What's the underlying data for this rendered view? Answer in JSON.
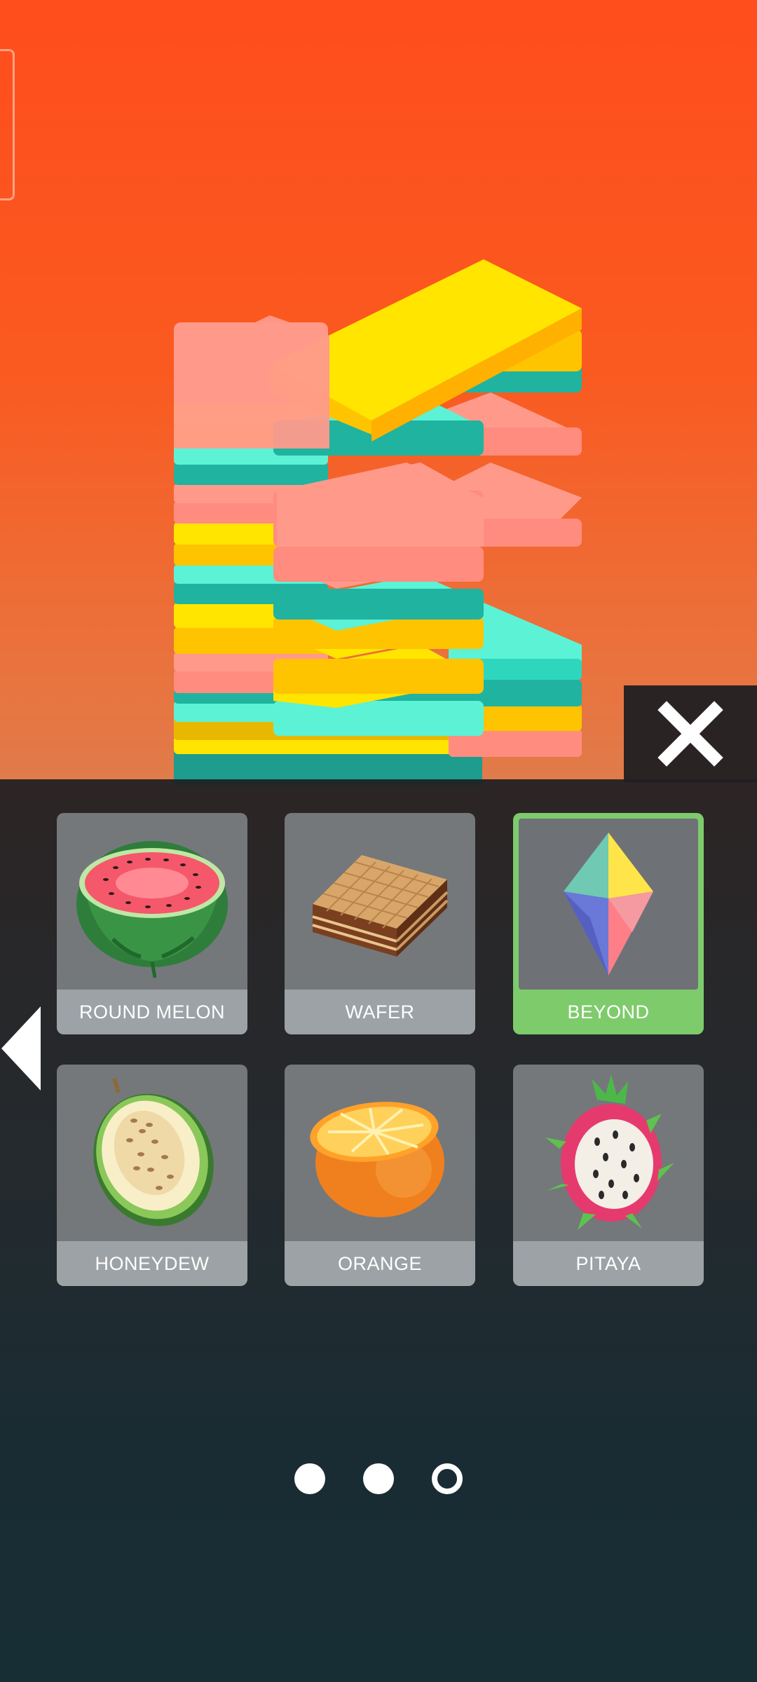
{
  "skins": {
    "items": [
      {
        "label": "ROUND MELON",
        "icon": "watermelon-icon",
        "selected": false
      },
      {
        "label": "WAFER",
        "icon": "wafer-icon",
        "selected": false
      },
      {
        "label": "BEYOND",
        "icon": "crystal-icon",
        "selected": true
      },
      {
        "label": "HONEYDEW",
        "icon": "honeydew-icon",
        "selected": false
      },
      {
        "label": "ORANGE",
        "icon": "orange-icon",
        "selected": false
      },
      {
        "label": "PITAYA",
        "icon": "pitaya-icon",
        "selected": false
      }
    ]
  },
  "pagination": {
    "pages": 3,
    "current_page": 3
  },
  "colors": {
    "background_top": "#FF4D1C",
    "selected_accent": "#7ECB6C",
    "block_yellow": "#FFE500",
    "block_pink": "#FF9A8B",
    "block_cyan": "#5CF2D6",
    "overlay": "#1E1E22"
  }
}
